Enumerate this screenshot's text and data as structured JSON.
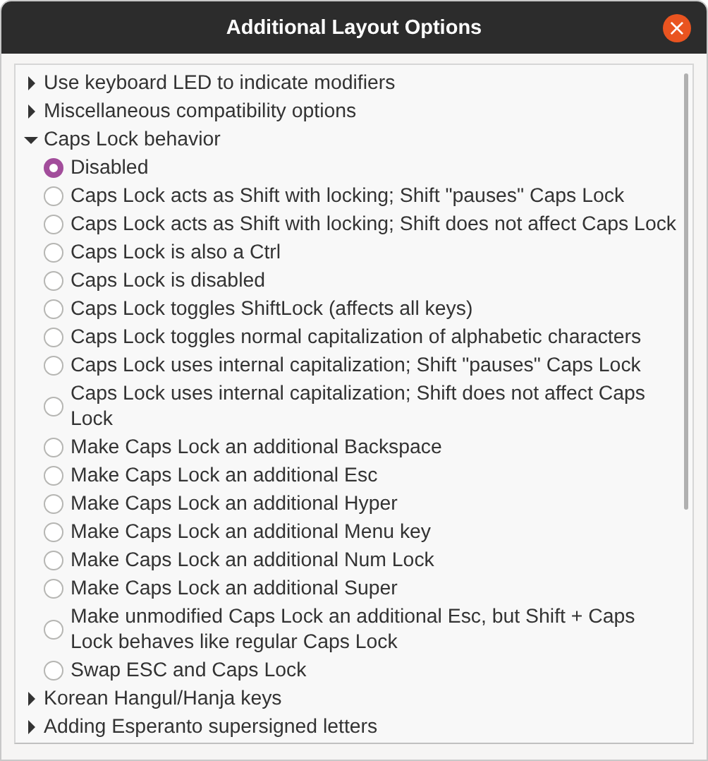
{
  "window": {
    "title": "Additional Layout Options",
    "close_label": "×"
  },
  "groups": [
    {
      "label": "Use keyboard LED to indicate modifiers",
      "expanded": false
    },
    {
      "label": "Miscellaneous compatibility options",
      "expanded": false
    },
    {
      "label": "Caps Lock behavior",
      "expanded": true,
      "children": [
        {
          "label": "Disabled",
          "selected": true
        },
        {
          "label": "Caps Lock acts as Shift with locking; Shift \"pauses\" Caps Lock",
          "selected": false
        },
        {
          "label": "Caps Lock acts as Shift with locking; Shift does not affect Caps Lock",
          "selected": false
        },
        {
          "label": "Caps Lock is also a Ctrl",
          "selected": false
        },
        {
          "label": "Caps Lock is disabled",
          "selected": false
        },
        {
          "label": "Caps Lock toggles ShiftLock (affects all keys)",
          "selected": false
        },
        {
          "label": "Caps Lock toggles normal capitalization of alphabetic characters",
          "selected": false
        },
        {
          "label": "Caps Lock uses internal capitalization; Shift \"pauses\" Caps Lock",
          "selected": false
        },
        {
          "label": "Caps Lock uses internal capitalization; Shift does not affect Caps Lock",
          "selected": false
        },
        {
          "label": "Make Caps Lock an additional Backspace",
          "selected": false
        },
        {
          "label": "Make Caps Lock an additional Esc",
          "selected": false
        },
        {
          "label": "Make Caps Lock an additional Hyper",
          "selected": false
        },
        {
          "label": "Make Caps Lock an additional Menu key",
          "selected": false
        },
        {
          "label": "Make Caps Lock an additional Num Lock",
          "selected": false
        },
        {
          "label": "Make Caps Lock an additional Super",
          "selected": false
        },
        {
          "label": "Make unmodified Caps Lock an additional Esc, but Shift + Caps Lock behaves like regular Caps Lock",
          "selected": false
        },
        {
          "label": "Swap ESC and Caps Lock",
          "selected": false
        }
      ]
    },
    {
      "label": "Korean Hangul/Hanja keys",
      "expanded": false
    },
    {
      "label": "Adding Esperanto supersigned letters",
      "expanded": false
    }
  ]
}
